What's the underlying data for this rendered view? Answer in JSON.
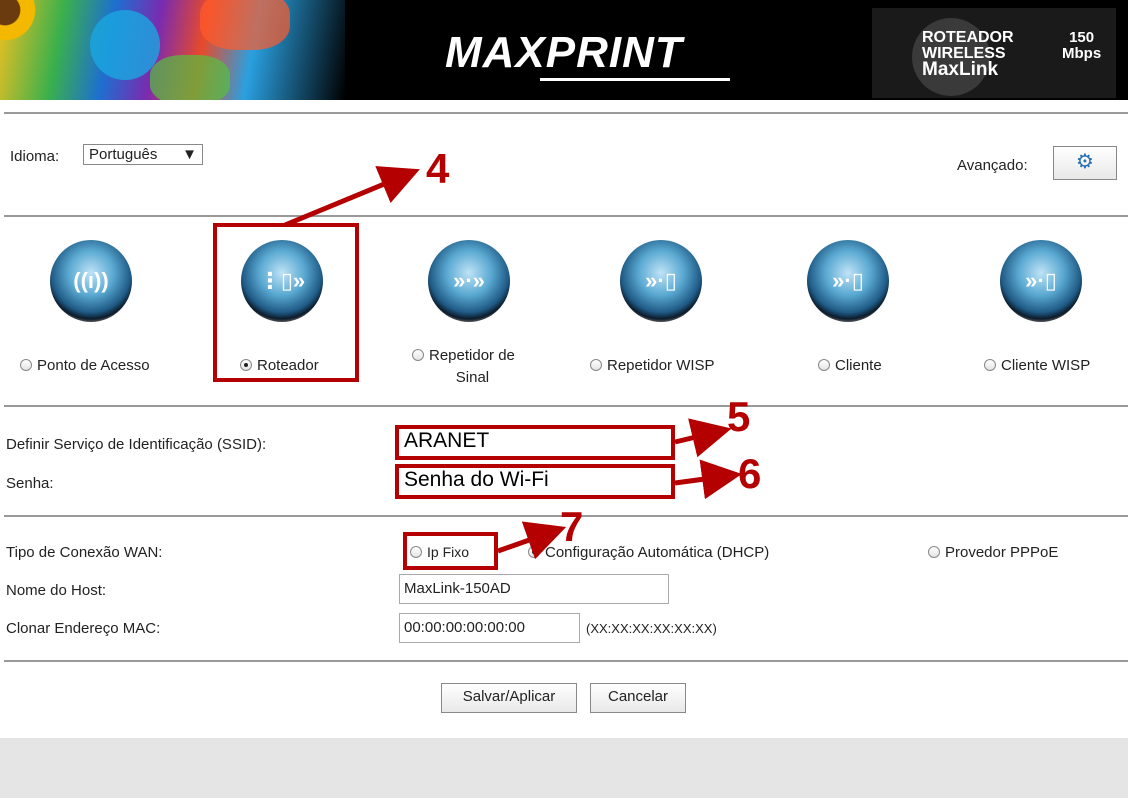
{
  "banner": {
    "brand": "MAXPRINT",
    "badge_line1": "ROTEADOR",
    "badge_line2": "WIRELESS",
    "badge_line3": "MaxLink",
    "badge_speed1": "150",
    "badge_speed2": "Mbps"
  },
  "header": {
    "language_label": "Idioma:",
    "language_value": "Português",
    "advanced_label": "Avançado:"
  },
  "modes": [
    {
      "label": "Ponto de Acesso",
      "icon": "access-point-icon",
      "selected": false
    },
    {
      "label": "Roteador",
      "icon": "router-icon",
      "selected": true
    },
    {
      "label_line1": "Repetidor de",
      "label_line2": "Sinal",
      "icon": "repeater-icon",
      "selected": false
    },
    {
      "label": "Repetidor WISP",
      "icon": "wisp-repeater-icon",
      "selected": false
    },
    {
      "label": "Cliente",
      "icon": "client-icon",
      "selected": false
    },
    {
      "label": "Cliente WISP",
      "icon": "wisp-client-icon",
      "selected": false
    }
  ],
  "wifi": {
    "ssid_label": "Definir Serviço de Identificação (SSID):",
    "ssid_value": "ARANET",
    "password_label": "Senha:",
    "password_value": "Senha do Wi-Fi"
  },
  "wan": {
    "type_label": "Tipo de Conexão WAN:",
    "option_static": "Ip Fixo",
    "option_dhcp": "Configuração Automática (DHCP)",
    "option_pppoe": "Provedor PPPoE",
    "selected": "dhcp",
    "host_label": "Nome do Host:",
    "host_value": "MaxLink-150AD",
    "mac_label": "Clonar Endereço MAC:",
    "mac_value": "00:00:00:00:00:00",
    "mac_hint": "(XX:XX:XX:XX:XX:XX)"
  },
  "actions": {
    "save": "Salvar/Aplicar",
    "cancel": "Cancelar"
  },
  "annotations": {
    "n4": "4",
    "n5": "5",
    "n6": "6",
    "n7": "7",
    "color": "#b40000"
  }
}
